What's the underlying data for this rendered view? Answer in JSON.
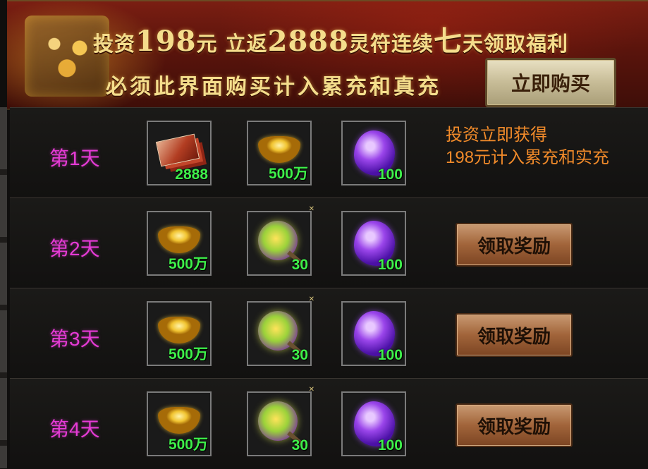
{
  "banner": {
    "line1": {
      "p1": "投资",
      "amount": "198",
      "p2": "元 立返",
      "reward": "2888",
      "p3": "灵符连续",
      "seven": "七",
      "p4": "天领取福利"
    },
    "line2": "必须此界面购买计入累充和真充",
    "buy_label": "立即购买"
  },
  "notice": {
    "line1": "投资立即获得",
    "line2": "198元计入累充和实充"
  },
  "days": [
    {
      "label": "第1天",
      "items": [
        {
          "icon": "talisman-icon",
          "count": "2888"
        },
        {
          "icon": "gold-ingot-icon",
          "count": "500万"
        },
        {
          "icon": "purple-gem-icon",
          "count": "100"
        }
      ]
    },
    {
      "label": "第2天",
      "items": [
        {
          "icon": "gold-ingot-icon",
          "count": "500万"
        },
        {
          "icon": "spirit-orb-icon",
          "count": "30"
        },
        {
          "icon": "purple-gem-icon",
          "count": "100"
        }
      ],
      "button": "领取奖励"
    },
    {
      "label": "第3天",
      "items": [
        {
          "icon": "gold-ingot-icon",
          "count": "500万"
        },
        {
          "icon": "spirit-orb-icon",
          "count": "30"
        },
        {
          "icon": "purple-gem-icon",
          "count": "100"
        }
      ],
      "button": "领取奖励"
    },
    {
      "label": "第4天",
      "items": [
        {
          "icon": "gold-ingot-icon",
          "count": "500万"
        },
        {
          "icon": "spirit-orb-icon",
          "count": "30"
        },
        {
          "icon": "purple-gem-icon",
          "count": "100"
        }
      ],
      "button": "领取奖励"
    }
  ],
  "colors": {
    "day_label": "#e63bd6",
    "count": "#3ef04a",
    "notice": "#f08a2a",
    "banner_text": "#f4dd8c"
  }
}
